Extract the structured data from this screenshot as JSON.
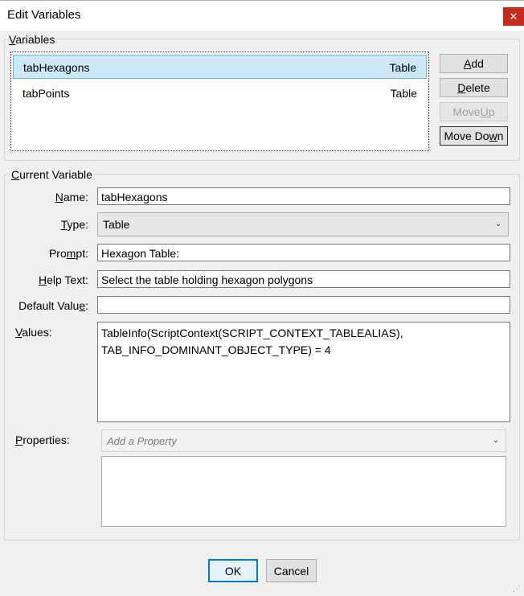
{
  "window": {
    "title": "Edit Variables",
    "close_glyph": "✕"
  },
  "variables_group": {
    "legend_first": "V",
    "legend_rest": "ariables",
    "items": [
      {
        "name": "tabHexagons",
        "type": "Table",
        "selected": true
      },
      {
        "name": "tabPoints",
        "type": "Table",
        "selected": false
      }
    ]
  },
  "list_buttons": {
    "add_u": "A",
    "add_rest": "dd",
    "delete_u": "D",
    "delete_rest": "elete",
    "moveup_pre": "Move ",
    "moveup_u": "U",
    "moveup_rest": "p",
    "movedown_pre": "Move Do",
    "movedown_u": "w",
    "movedown_rest": "n"
  },
  "current_group": {
    "legend_u": "C",
    "legend_rest": "urrent Variable"
  },
  "form": {
    "name_label_u": "N",
    "name_label_rest": "ame:",
    "name_value": "tabHexagons",
    "type_label_u": "T",
    "type_label_rest": "ype:",
    "type_value": "Table",
    "prompt_label_pre": "Pro",
    "prompt_label_u": "m",
    "prompt_label_rest": "pt:",
    "prompt_value": "Hexagon Table:",
    "help_label_u": "H",
    "help_label_rest": "elp Text:",
    "help_value": "Select the table holding hexagon polygons",
    "default_label_pre": "Default Valu",
    "default_label_u": "e",
    "default_label_rest": ":",
    "default_value": "",
    "values_label_u": "V",
    "values_label_rest": "alues:",
    "values_value": "TableInfo(ScriptContext(SCRIPT_CONTEXT_TABLEALIAS),\nTAB_INFO_DOMINANT_OBJECT_TYPE) = 4",
    "properties_label_u": "P",
    "properties_label_rest": "roperties:",
    "properties_placeholder": "Add a Property"
  },
  "dialog_buttons": {
    "ok": "OK",
    "cancel": "Cancel"
  },
  "icons": {
    "chevron": "⌄",
    "grip": "⋰"
  }
}
